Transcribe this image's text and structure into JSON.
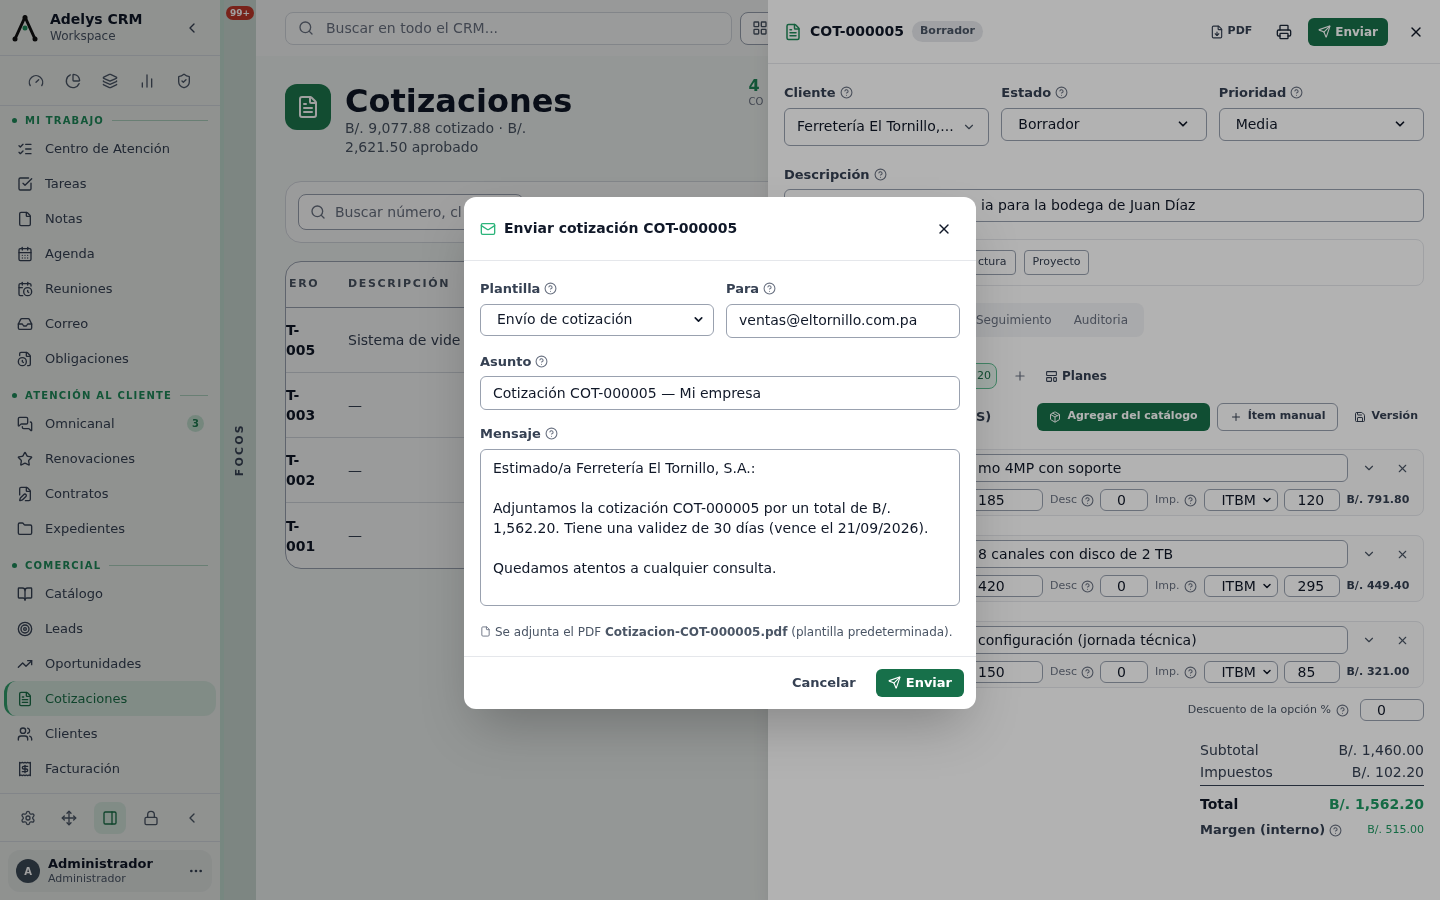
{
  "sidebar": {
    "brand": "Adelys CRM",
    "subtitle": "Workspace",
    "sections": [
      {
        "title": "MI TRABAJO",
        "items": [
          {
            "label": "Centro de Atención",
            "kind": "list",
            "selected": false
          },
          {
            "label": "Tareas",
            "kind": "task",
            "selected": false
          },
          {
            "label": "Notas",
            "kind": "note",
            "selected": false
          },
          {
            "label": "Agenda",
            "kind": "calendar",
            "selected": false
          },
          {
            "label": "Reuniones",
            "kind": "meeting",
            "selected": false
          },
          {
            "label": "Correo",
            "kind": "mail",
            "selected": false
          },
          {
            "label": "Obligaciones",
            "kind": "obligation",
            "selected": false
          }
        ]
      },
      {
        "title": "ATENCIÓN AL CLIENTE",
        "items": [
          {
            "label": "Omnicanal",
            "kind": "chat",
            "selected": false,
            "badge": "3"
          },
          {
            "label": "Renovaciones",
            "kind": "star",
            "selected": false
          },
          {
            "label": "Contratos",
            "kind": "contract",
            "selected": false
          },
          {
            "label": "Expedientes",
            "kind": "folder",
            "selected": false
          }
        ]
      },
      {
        "title": "COMERCIAL",
        "items": [
          {
            "label": "Catálogo",
            "kind": "book",
            "selected": false
          },
          {
            "label": "Leads",
            "kind": "target",
            "selected": false
          },
          {
            "label": "Oportunidades",
            "kind": "trend",
            "selected": false
          },
          {
            "label": "Cotizaciones",
            "kind": "quote",
            "selected": true
          },
          {
            "label": "Clientes",
            "kind": "users",
            "selected": false
          },
          {
            "label": "Facturación",
            "kind": "invoice",
            "selected": false
          }
        ]
      }
    ],
    "tools": [
      {
        "kind": "settings",
        "selected": false
      },
      {
        "kind": "move",
        "selected": false
      },
      {
        "kind": "panel",
        "selected": true
      },
      {
        "kind": "lock",
        "selected": false
      },
      {
        "kind": "collapse",
        "selected": false
      }
    ],
    "user": {
      "initial": "A",
      "name": "Administrador",
      "role": "Administrador"
    }
  },
  "notifications_badge": "99+",
  "focus_strip": {
    "label": "FOCOS"
  },
  "topbar": {
    "search": {
      "placeholder": "Buscar en todo el CRM..."
    }
  },
  "page": {
    "title": "Cotizaciones",
    "summary": "B/. 9,077.88 cotizado · B/. 2,621.50 aprobado",
    "stat": {
      "value": "4",
      "label": "CO"
    }
  },
  "filters": {
    "search": {
      "placeholder": "Buscar número, cl"
    }
  },
  "table": {
    "columns": [
      "ERO",
      "DESCRIPCIÓN"
    ],
    "rows": [
      [
        "T-005",
        "Sistema de vide"
      ],
      [
        "T-003",
        "—"
      ],
      [
        "T-002",
        "—"
      ],
      [
        "T-001",
        "—"
      ]
    ]
  },
  "drawer": {
    "title": "COT-000005",
    "status_badge": "Borrador",
    "pdf": "PDF",
    "send": "Enviar",
    "fields": [
      {
        "label": "Cliente",
        "value": "Ferretería El Tornillo,...",
        "kind": "combobox"
      },
      {
        "label": "Estado",
        "value": "Borrador",
        "kind": "select"
      },
      {
        "label": "Prioridad",
        "value": "Media",
        "kind": "select"
      }
    ],
    "description": {
      "label": "Descripción",
      "value": "ia para la bodega de Juan Díaz"
    },
    "tags": [
      "ctura",
      "Proyecto"
    ],
    "tabs": [
      {
        "label": "Seguimiento",
        "selected": false
      },
      {
        "label": "Auditoria",
        "selected": false
      }
    ],
    "option_tab": {
      "label": "20",
      "selected": true
    },
    "plans": "Planes",
    "section_label": "S)",
    "catalog_button": "Agregar del catálogo",
    "manual_button": "Ítem manual",
    "version_button": "Versión",
    "items": [
      {
        "name": "mo 4MP con soporte",
        "quantity": "185",
        "discount_label": "Desc",
        "discount": "0",
        "tax_label": "Imp.",
        "tax": "ITBM",
        "cost": "120",
        "total": "B/. 791.80"
      },
      {
        "name": "8 canales con disco de 2 TB",
        "quantity": "420",
        "discount_label": "Desc",
        "discount": "0",
        "tax_label": "Imp.",
        "tax": "ITBM",
        "cost": "295",
        "total": "B/. 449.40"
      },
      {
        "name": "configuración (jornada técnica)",
        "quantity": "150",
        "discount_label": "Desc",
        "discount": "0",
        "tax_label": "Imp.",
        "tax": "ITBM",
        "cost": "85",
        "total": "B/. 321.00"
      }
    ],
    "option_discount": {
      "label": "Descuento de la opción %",
      "value": "0"
    },
    "totals": [
      {
        "label": "Subtotal",
        "value": "B/. 1,460.00",
        "kind": "line"
      },
      {
        "label": "Impuestos",
        "value": "B/. 102.20",
        "kind": "line"
      },
      {
        "label": "Total",
        "value": "B/. 1,562.20",
        "kind": "total"
      },
      {
        "label": "Margen (interno)",
        "value": "B/. 515.00",
        "kind": "margin"
      }
    ]
  },
  "modal": {
    "title": "Enviar cotización COT-000005",
    "template": {
      "label": "Plantilla",
      "value": "Envío de cotización"
    },
    "to": {
      "label": "Para",
      "value": "ventas@eltornillo.com.pa"
    },
    "subject": {
      "label": "Asunto",
      "value": "Cotización COT-000005 — Mi empresa"
    },
    "message": {
      "label": "Mensaje",
      "paragraphs": [
        "Estimado/a Ferretería El Tornillo, S.A.:",
        "Adjuntamos la cotización COT-000005 por un total de B/. 1,562.20. Tiene una validez de 30 días (vence el 21/09/2026).",
        "Quedamos atentos a cualquier consulta."
      ]
    },
    "attachment": "Se adjunta el PDF **Cotizacion-COT-000005.pdf** (plantilla predeterminada).",
    "cancel": "Cancelar",
    "send": "Enviar"
  }
}
